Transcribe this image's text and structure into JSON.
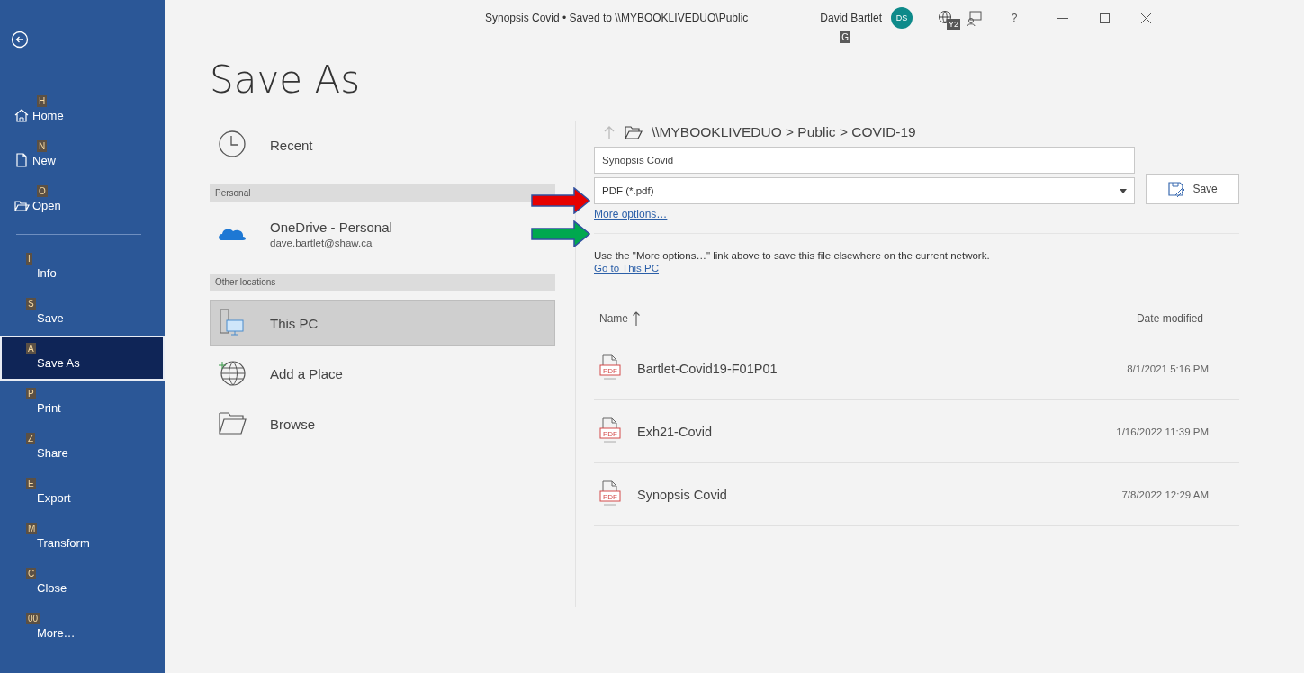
{
  "window": {
    "title": "Synopsis Covid • Saved to \\\\MYBOOKLIVEDUO\\Public",
    "user": "David Bartlet",
    "user_keytip": "G",
    "avatar": "DS",
    "globe_keytip": "Y2",
    "help": "?"
  },
  "sidebar": {
    "groups": [
      [
        {
          "label": "Home",
          "keytip": "H",
          "selected": false
        },
        {
          "label": "New",
          "keytip": "N",
          "selected": false
        },
        {
          "label": "Open",
          "keytip": "O",
          "selected": false
        }
      ],
      [
        {
          "label": "Info",
          "keytip": "I",
          "selected": false
        },
        {
          "label": "Save",
          "keytip": "S",
          "selected": false
        },
        {
          "label": "Save As",
          "keytip": "A",
          "selected": true
        },
        {
          "label": "Print",
          "keytip": "P",
          "selected": false
        },
        {
          "label": "Share",
          "keytip": "Z",
          "selected": false
        },
        {
          "label": "Export",
          "keytip": "E",
          "selected": false
        },
        {
          "label": "Transform",
          "keytip": "M",
          "selected": false
        },
        {
          "label": "Close",
          "keytip": "C",
          "selected": false
        },
        {
          "label": "More…",
          "keytip": "00",
          "selected": false
        }
      ]
    ]
  },
  "heading": "Save As",
  "places": [
    {
      "kind": "place",
      "label": "Recent",
      "selected": false
    },
    {
      "kind": "header",
      "label": "Personal"
    },
    {
      "kind": "place",
      "label": "OneDrive - Personal",
      "subtitle": "dave.bartlet@shaw.ca",
      "selected": false
    },
    {
      "kind": "header",
      "label": "Other locations"
    },
    {
      "kind": "place",
      "label": "This PC",
      "selected": true
    },
    {
      "kind": "place",
      "label": "Add a Place",
      "selected": false
    },
    {
      "kind": "place",
      "label": "Browse",
      "selected": false
    }
  ],
  "save": {
    "path": "\\\\MYBOOKLIVEDUO > Public > COVID-19",
    "file_name": "Synopsis Covid",
    "file_type": "PDF (*.pdf)",
    "save_button": "Save",
    "more_options_link": "More options…",
    "note": "Use the \"More options…\" link above to save this file elsewhere on the current network.",
    "this_pc_link": "Go to This PC"
  },
  "table": {
    "columns": [
      "Name",
      "Date modified"
    ],
    "rows": [
      {
        "icon_label": "PDF",
        "name": "Bartlet-Covid19-F01P01",
        "date": "8/1/2021 5:16 PM"
      },
      {
        "icon_label": "PDF",
        "name": "Exh21-Covid",
        "date": "1/16/2022 11:39 PM"
      },
      {
        "icon_label": "PDF",
        "name": "Synopsis Covid",
        "date": "7/8/2022 12:29 AM"
      }
    ]
  }
}
